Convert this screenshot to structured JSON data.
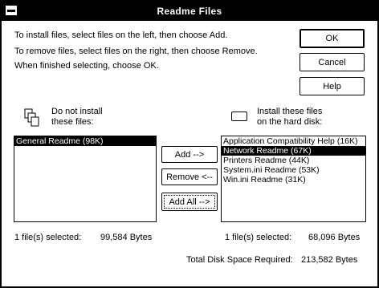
{
  "window": {
    "title": "Readme Files"
  },
  "instructions": [
    "To install files, select files on the left, then choose Add.",
    "To remove files, select files on the right, then choose Remove.",
    "When finished selecting, choose OK."
  ],
  "buttons": {
    "ok": "OK",
    "cancel": "Cancel",
    "help": "Help",
    "add": "Add -->",
    "remove": "Remove <--",
    "add_all": "Add All -->"
  },
  "left_panel": {
    "label_line1": "Do not install",
    "label_line2": "these files:",
    "icon": "files-icon",
    "items": [
      {
        "text": "General Readme (98K)",
        "selected": true
      }
    ],
    "status_count": "1  file(s) selected:",
    "status_bytes": "99,584  Bytes"
  },
  "right_panel": {
    "label_line1": "Install these files",
    "label_line2": "on the hard disk:",
    "icon": "disk-icon",
    "items": [
      {
        "text": "Application Compatibility Help (16K)",
        "selected": false
      },
      {
        "text": "Network Readme (67K)",
        "selected": true
      },
      {
        "text": "Printers Readme (44K)",
        "selected": false
      },
      {
        "text": "System.ini Readme (53K)",
        "selected": false
      },
      {
        "text": "Win.ini Readme (31K)",
        "selected": false
      }
    ],
    "status_count": "1  file(s) selected:",
    "status_bytes": "68,096  Bytes"
  },
  "total": {
    "label": "Total Disk Space Required:",
    "value": "213,582  Bytes"
  }
}
